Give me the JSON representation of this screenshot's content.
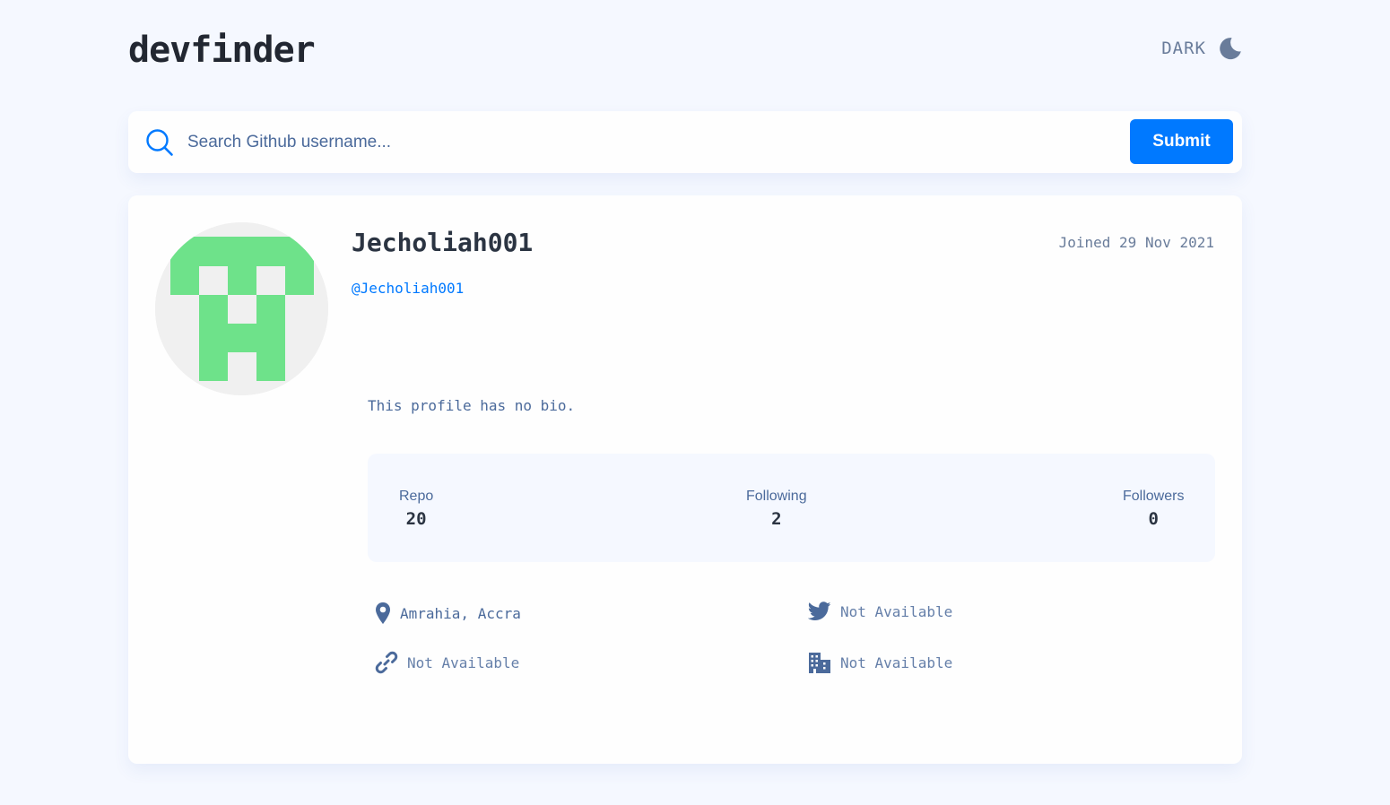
{
  "header": {
    "logo": "devfinder",
    "theme_label": "DARK",
    "theme_icon": "moon-icon"
  },
  "search": {
    "placeholder": "Search Github username...",
    "value": "",
    "submit_label": "Submit",
    "icon": "search-icon"
  },
  "profile": {
    "name": "Jecholiah001",
    "login": "@Jecholiah001",
    "joined": "Joined 29 Nov 2021",
    "bio": "This profile has no bio.",
    "stats": {
      "repo_label": "Repo",
      "repo_value": "20",
      "following_label": "Following",
      "following_value": "2",
      "followers_label": "Followers",
      "followers_value": "0"
    },
    "links": {
      "location": "Amrahia, Accra",
      "twitter": "Not Available",
      "blog": "Not Available",
      "company": "Not Available"
    }
  },
  "colors": {
    "background": "#f5f8ff",
    "card": "#fefefe",
    "accent": "#0079ff",
    "text_primary": "#2b3442",
    "text_secondary": "#4b6a9b",
    "muted": "#697c9a",
    "avatar_green": "#6ee28a",
    "avatar_bg": "#f0f0f0"
  }
}
